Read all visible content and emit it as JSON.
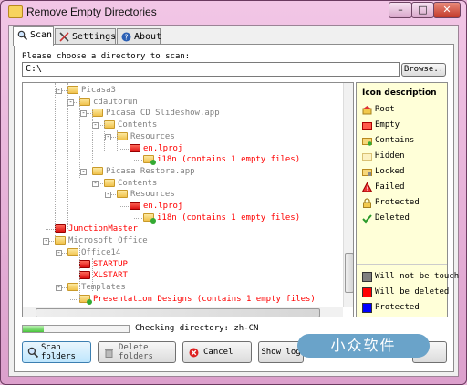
{
  "window": {
    "title": "Remove Empty Directories",
    "buttons": {
      "minimize": "–",
      "maximize": "□",
      "close": "✕"
    }
  },
  "tabs": [
    {
      "label": "Scan",
      "icon": "magnifier-icon",
      "active": true
    },
    {
      "label": "Settings",
      "icon": "tools-icon",
      "active": false
    },
    {
      "label": "About",
      "icon": "help-icon",
      "active": false
    }
  ],
  "scan": {
    "prompt": "Please choose a directory to scan:",
    "path_value": "C:\\",
    "browse_label": "Browse.."
  },
  "tree": [
    {
      "label": "Picasa3",
      "type": "normal"
    },
    {
      "label": "cdautorun",
      "type": "normal"
    },
    {
      "label": "Picasa CD Slideshow.app",
      "type": "normal"
    },
    {
      "label": "Contents",
      "type": "normal"
    },
    {
      "label": "Resources",
      "type": "normal"
    },
    {
      "label": "en.lproj",
      "type": "empty"
    },
    {
      "label": "i18n (contains 1 empty files)",
      "type": "contains"
    },
    {
      "label": "Picasa Restore.app",
      "type": "normal"
    },
    {
      "label": "Contents",
      "type": "normal"
    },
    {
      "label": "Resources",
      "type": "normal"
    },
    {
      "label": "en.lproj",
      "type": "empty"
    },
    {
      "label": "i18n (contains 1 empty files)",
      "type": "contains"
    },
    {
      "label": "JunctionMaster",
      "type": "empty"
    },
    {
      "label": "Microsoft Office",
      "type": "normal"
    },
    {
      "label": "Office14",
      "type": "normal"
    },
    {
      "label": "STARTUP",
      "type": "empty"
    },
    {
      "label": "XLSTART",
      "type": "empty"
    },
    {
      "label": "Templates",
      "type": "normal"
    },
    {
      "label": "Presentation Designs (contains 1 empty files)",
      "type": "contains"
    }
  ],
  "icon_description": {
    "title": "Icon description",
    "items": [
      {
        "label": "Root",
        "icon": "root-icon"
      },
      {
        "label": "Empty",
        "icon": "empty-folder-icon"
      },
      {
        "label": "Contains",
        "icon": "contains-folder-icon"
      },
      {
        "label": "Hidden",
        "icon": "hidden-folder-icon"
      },
      {
        "label": "Locked",
        "icon": "locked-folder-icon"
      },
      {
        "label": "Failed",
        "icon": "warning-icon"
      },
      {
        "label": "Protected",
        "icon": "lock-icon"
      },
      {
        "label": "Deleted",
        "icon": "checkmark-icon"
      }
    ],
    "colors": [
      {
        "label": "Will not be touch",
        "color": "#808080"
      },
      {
        "label": "Will be deleted",
        "color": "#ff0000"
      },
      {
        "label": "Protected",
        "color": "#0000ff"
      }
    ]
  },
  "status": {
    "text": "Checking directory: zh-CN",
    "progress": 0.2
  },
  "actions": {
    "scan": "Scan\nfolders",
    "delete": "Delete\nfolders",
    "cancel": "Cancel",
    "show_log": "Show log"
  },
  "watermark": "小众软件",
  "colors": {
    "empty_text": "#ff0000",
    "normal_text": "#808080",
    "accent": "#48c43a"
  }
}
